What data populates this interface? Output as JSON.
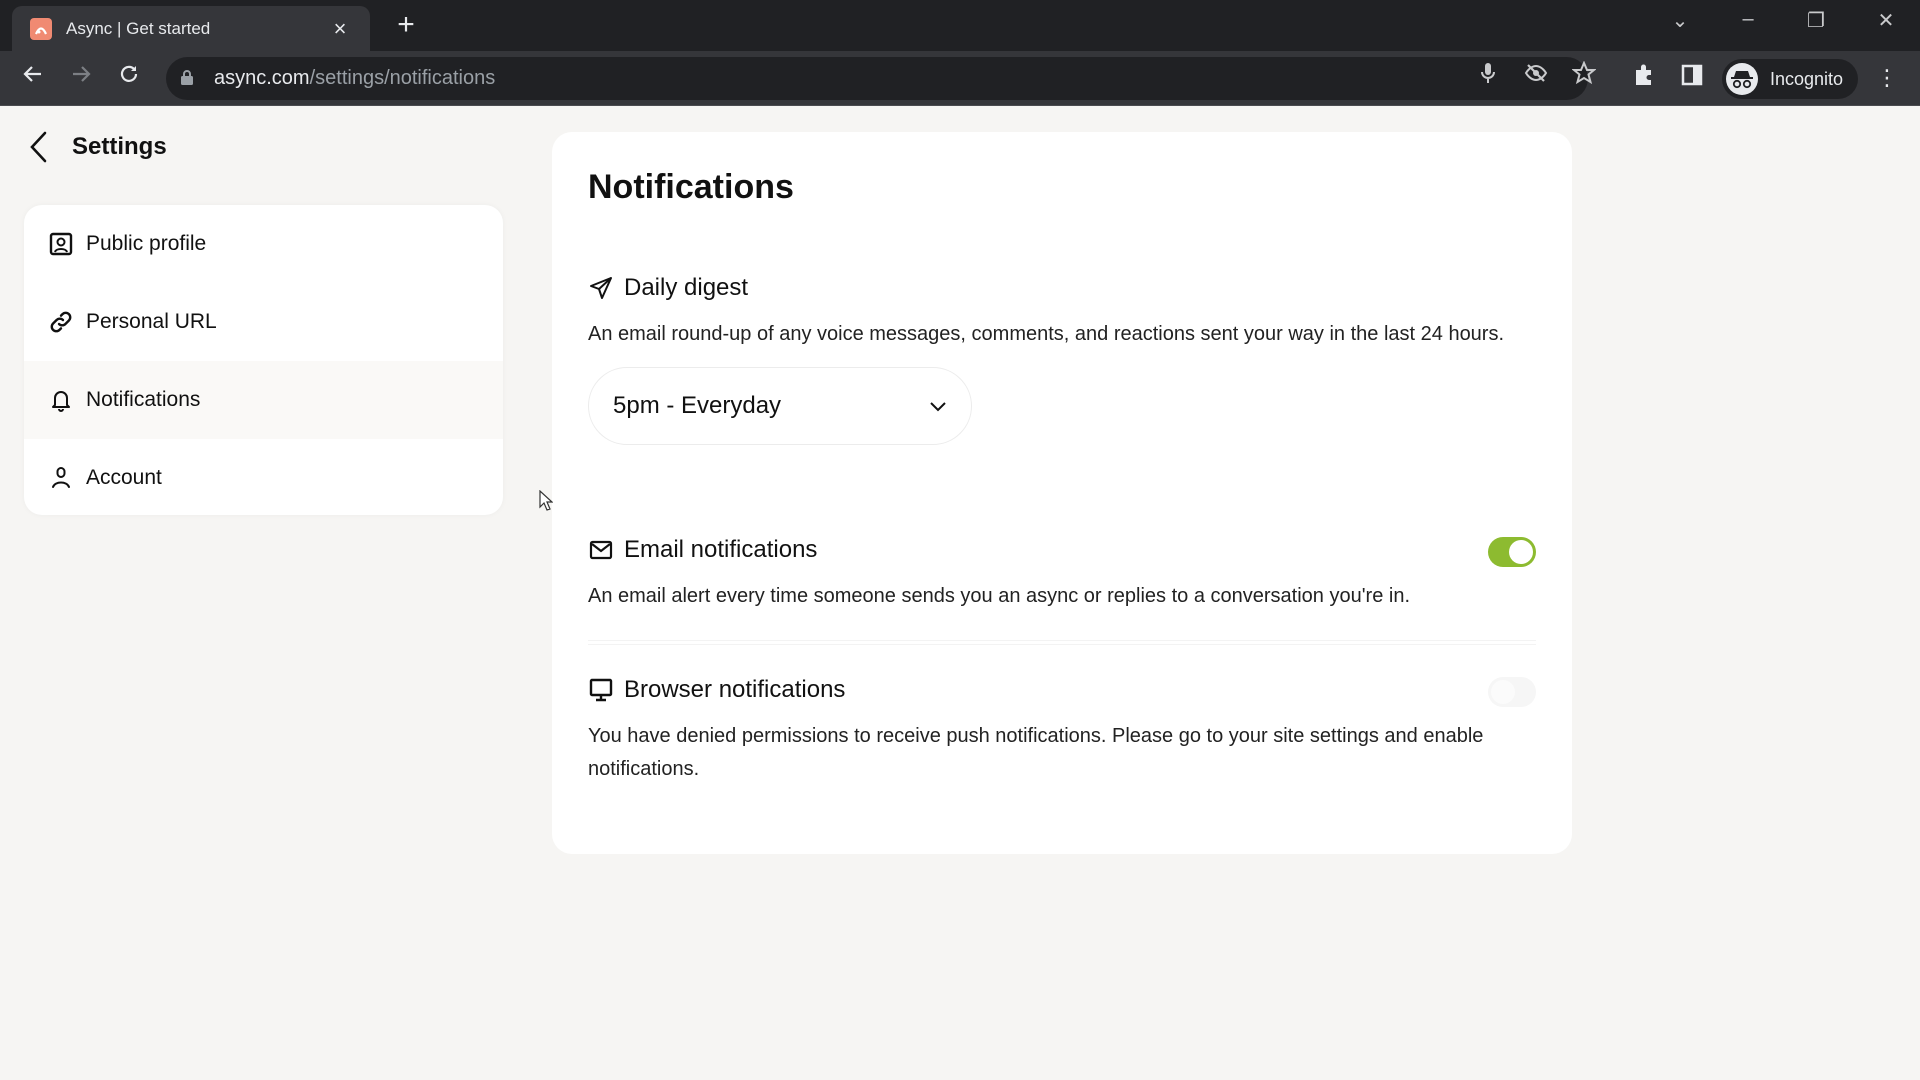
{
  "browser": {
    "tab_title": "Async | Get started",
    "tab_close": "×",
    "new_tab": "+",
    "url_host": "async.com",
    "url_path": "/settings/notifications",
    "profile_label": "Incognito",
    "icons": [
      "back-arrow-icon",
      "forward-arrow-icon",
      "reload-icon",
      "lock-icon",
      "microphone-icon",
      "eye-off-icon",
      "star-icon",
      "extensions-icon",
      "side-panel-icon",
      "incognito-icon",
      "more-menu-icon"
    ]
  },
  "window_controls": {
    "tab_search": "⌄",
    "minimize": "–",
    "restore": "❐",
    "close": "✕"
  },
  "sidebar": {
    "back_label": "Settings",
    "items": [
      {
        "label": "Public profile",
        "icon": "profile-card-icon",
        "active": false
      },
      {
        "label": "Personal URL",
        "icon": "link-icon",
        "active": false
      },
      {
        "label": "Notifications",
        "icon": "bell-icon",
        "active": true
      },
      {
        "label": "Account",
        "icon": "user-icon",
        "active": false
      }
    ]
  },
  "main": {
    "title": "Notifications",
    "sections": {
      "daily_digest": {
        "title": "Daily digest",
        "icon": "send-icon",
        "description": "An email round-up of any voice messages, comments, and reactions sent your way in the last 24 hours.",
        "select_value": "5pm - Everyday"
      },
      "email": {
        "title": "Email notifications",
        "icon": "mail-icon",
        "description": "An email alert every time someone sends you an async or replies to a conversation you're in.",
        "enabled": true
      },
      "browser": {
        "title": "Browser notifications",
        "icon": "monitor-icon",
        "description": "You have denied permissions to receive push notifications. Please go to your site settings and enable notifications.",
        "enabled": false
      }
    }
  },
  "colors": {
    "accent_toggle": "#8dbb30",
    "page_bg": "#f6f5f3",
    "favicon": "#f08a72"
  }
}
